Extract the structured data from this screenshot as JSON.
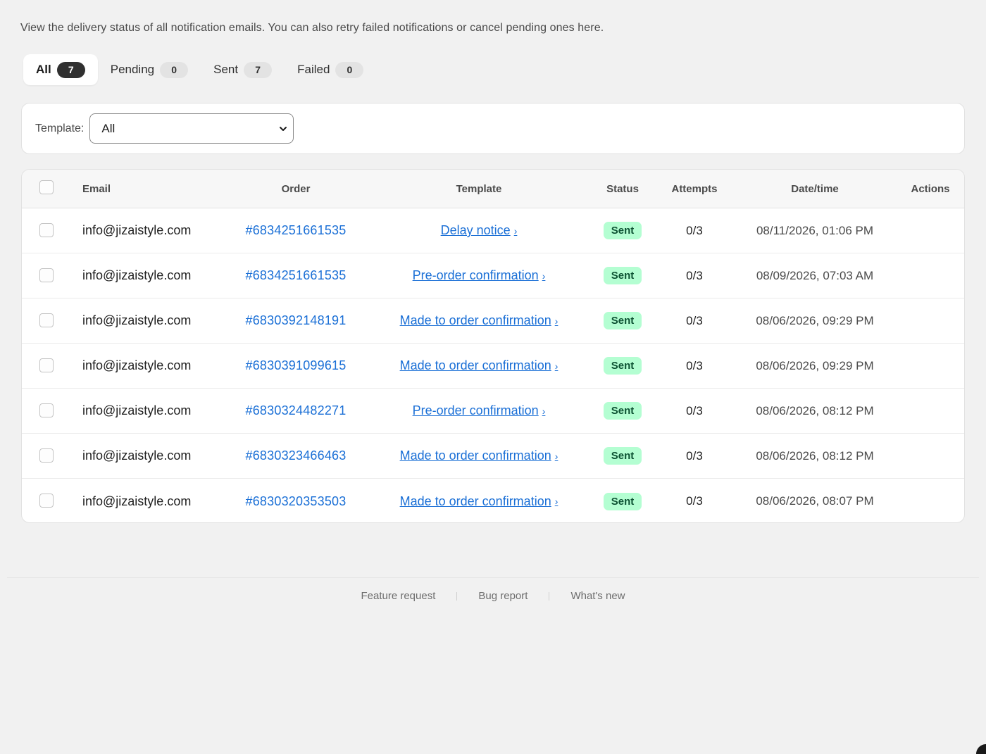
{
  "intro": "View the delivery status of all notification emails. You can also retry failed notifications or cancel pending ones here.",
  "tabs": [
    {
      "label": "All",
      "count": "7",
      "active": true
    },
    {
      "label": "Pending",
      "count": "0",
      "active": false
    },
    {
      "label": "Sent",
      "count": "7",
      "active": false
    },
    {
      "label": "Failed",
      "count": "0",
      "active": false
    }
  ],
  "filter": {
    "label": "Template:",
    "value": "All"
  },
  "table": {
    "headers": {
      "email": "Email",
      "order": "Order",
      "template": "Template",
      "status": "Status",
      "attempts": "Attempts",
      "datetime": "Date/time",
      "actions": "Actions"
    },
    "rows": [
      {
        "email": "info@jizaistyle.com",
        "order": "#6834251661535",
        "template": "Delay notice",
        "status": "Sent",
        "attempts": "0/3",
        "datetime": "08/11/2026, 01:06 PM"
      },
      {
        "email": "info@jizaistyle.com",
        "order": "#6834251661535",
        "template": "Pre-order confirmation",
        "status": "Sent",
        "attempts": "0/3",
        "datetime": "08/09/2026, 07:03 AM"
      },
      {
        "email": "info@jizaistyle.com",
        "order": "#6830392148191",
        "template": "Made to order confirmation",
        "status": "Sent",
        "attempts": "0/3",
        "datetime": "08/06/2026, 09:29 PM"
      },
      {
        "email": "info@jizaistyle.com",
        "order": "#6830391099615",
        "template": "Made to order confirmation",
        "status": "Sent",
        "attempts": "0/3",
        "datetime": "08/06/2026, 09:29 PM"
      },
      {
        "email": "info@jizaistyle.com",
        "order": "#6830324482271",
        "template": "Pre-order confirmation",
        "status": "Sent",
        "attempts": "0/3",
        "datetime": "08/06/2026, 08:12 PM"
      },
      {
        "email": "info@jizaistyle.com",
        "order": "#6830323466463",
        "template": "Made to order confirmation",
        "status": "Sent",
        "attempts": "0/3",
        "datetime": "08/06/2026, 08:12 PM"
      },
      {
        "email": "info@jizaistyle.com",
        "order": "#6830320353503",
        "template": "Made to order confirmation",
        "status": "Sent",
        "attempts": "0/3",
        "datetime": "08/06/2026, 08:07 PM"
      }
    ]
  },
  "footer": {
    "feature_request": "Feature request",
    "bug_report": "Bug report",
    "whats_new": "What's new"
  },
  "colors": {
    "accent_link": "#1a6fd6",
    "sent_badge_bg": "#b4fed2",
    "sent_badge_text": "#0c5132",
    "background": "#f1f1f1"
  }
}
